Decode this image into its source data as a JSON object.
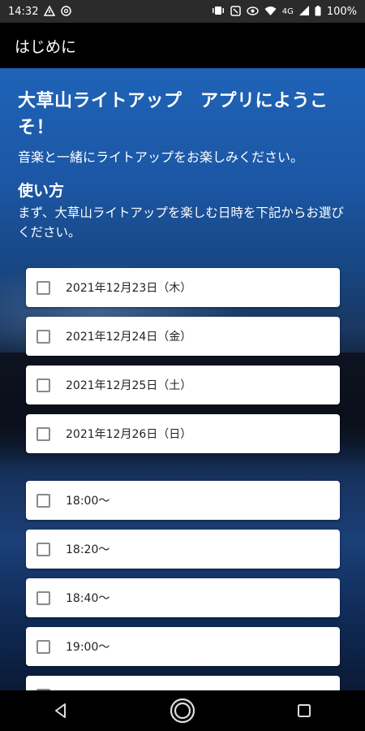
{
  "status_bar": {
    "time": "14:32",
    "network": "4G",
    "battery": "100%",
    "icons_left": [
      "signal-alert-icon",
      "at-icon"
    ],
    "icons_right": [
      "vibrate-icon",
      "nfc-icon",
      "eye-icon",
      "wifi-icon",
      "cell-signal-icon",
      "battery-icon"
    ]
  },
  "app_bar": {
    "title": "はじめに"
  },
  "intro": {
    "title": "大草山ライトアップ　アプリにようこそ！",
    "subtitle": "音楽と一緒にライトアップをお楽しみください。",
    "howto_heading": "使い方",
    "howto_desc": "まず、大草山ライトアップを楽しむ日時を下記からお選びください。"
  },
  "dates": [
    {
      "label": "2021年12月23日（木）",
      "checked": false
    },
    {
      "label": "2021年12月24日（金）",
      "checked": false
    },
    {
      "label": "2021年12月25日（土）",
      "checked": false
    },
    {
      "label": "2021年12月26日（日）",
      "checked": false
    }
  ],
  "times": [
    {
      "label": "18:00〜",
      "checked": false
    },
    {
      "label": "18:20〜",
      "checked": false
    },
    {
      "label": "18:40〜",
      "checked": false
    },
    {
      "label": "19:00〜",
      "checked": false
    },
    {
      "label": "",
      "checked": false
    }
  ],
  "nav": {
    "icons": [
      "back-icon",
      "home-icon",
      "recents-icon"
    ]
  },
  "colors": {
    "app_bar": "#000000",
    "background_top": "#1f63b7",
    "card": "#ffffff",
    "checkbox_border": "#8a8a8a"
  }
}
